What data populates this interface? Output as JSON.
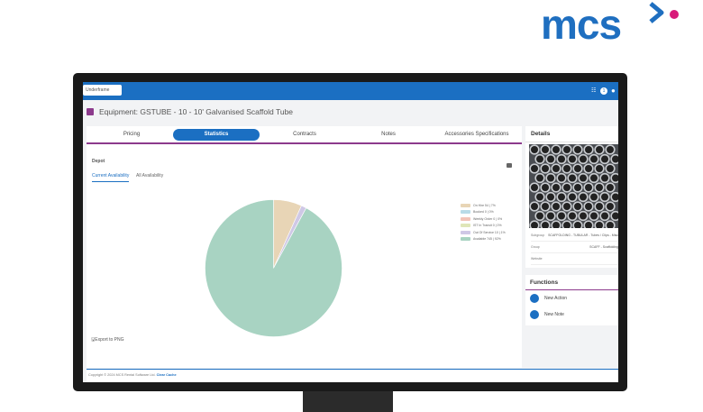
{
  "brand": {
    "logo_text": "mcs",
    "accent_colors": [
      "#1f6fc0",
      "#d81b7a"
    ]
  },
  "header": {
    "search_value": "Underframe",
    "notification_count": "1"
  },
  "page": {
    "title": "Equipment: GSTUBE - 10 - 10' Galvanised Scaffold Tube"
  },
  "tabs": [
    {
      "label": "Pricing",
      "active": false
    },
    {
      "label": "Statistics",
      "active": true
    },
    {
      "label": "Contracts",
      "active": false
    },
    {
      "label": "Notes",
      "active": false
    },
    {
      "label": "Accessories Specifications",
      "active": false
    }
  ],
  "statistics": {
    "depot_label": "Depot",
    "sub_tabs": [
      {
        "label": "Current Availability",
        "active": true
      },
      {
        "label": "All Availability",
        "active": false
      }
    ],
    "export_label": "Export to PNG"
  },
  "chart_data": {
    "type": "pie",
    "categories": [
      "On Hire 54",
      "Booked 0",
      "Weekly Order 0",
      "IST In Transit 0",
      "Out Of Service 10",
      "Available 745"
    ],
    "legend": [
      "On Hire 54 | 7%",
      "Booked 0 | 0%",
      "Weekly Order 0 | 0%",
      "IST In Transit 0 | 0%",
      "Out Of Service 10 | 1%",
      "Available 745 | 92%"
    ],
    "values": [
      54,
      0,
      0,
      0,
      10,
      745
    ],
    "colors": [
      "#e8d5b6",
      "#b9dbe8",
      "#f2c4b8",
      "#dfe6b8",
      "#cfc8e6",
      "#a8d3c2"
    ],
    "legend_position": "right"
  },
  "details": {
    "title": "Details",
    "rows": [
      {
        "key": "Subgroup",
        "value": "SCAFFOLDING - TUBULAR - Tubes / Clips - Misc"
      },
      {
        "key": "Group",
        "value": "SCAFF - Scaffolding"
      },
      {
        "key": "Website",
        "value": ""
      }
    ]
  },
  "functions": {
    "title": "Functions",
    "items": [
      {
        "label": "New Action"
      },
      {
        "label": "New Note"
      }
    ]
  },
  "footer": {
    "copyright": "Copyright © 2024 MCS Rental Software Ltd.",
    "link": "Clear Cache"
  }
}
